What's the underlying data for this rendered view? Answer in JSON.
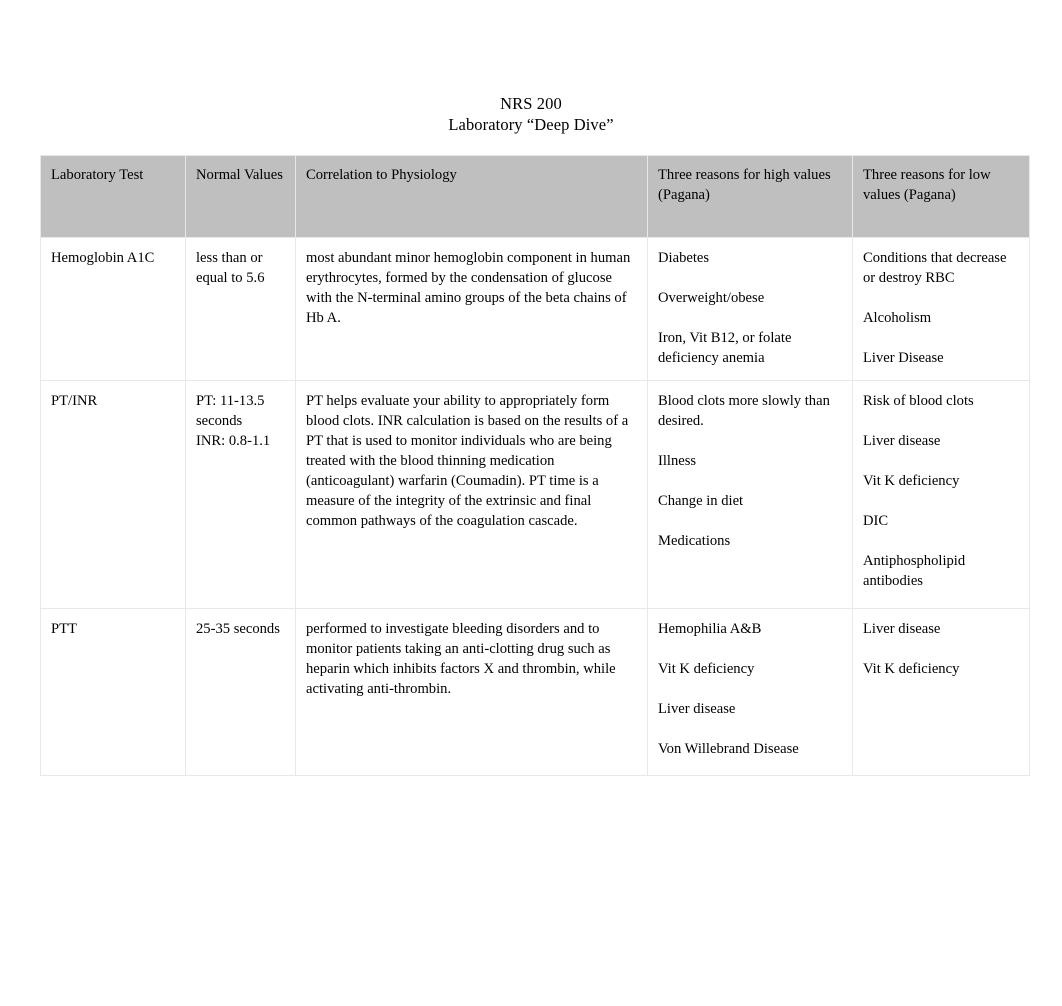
{
  "document": {
    "title_lines": [
      "NRS 200",
      "Laboratory “Deep Dive”"
    ],
    "header_background": "#bfbfbf",
    "page_background": "#ffffff",
    "text_color": "#000000"
  },
  "table": {
    "columns": [
      {
        "key": "test",
        "label": "Laboratory Test"
      },
      {
        "key": "normal",
        "label": "Normal Values"
      },
      {
        "key": "corr",
        "label": "Correlation to Physiology"
      },
      {
        "key": "high",
        "label": "Three reasons for high values (Pagana)"
      },
      {
        "key": "low",
        "label": "Three reasons for low values (Pagana)"
      }
    ],
    "rows": [
      {
        "test": "Hemoglobin A1C",
        "normal": "less than or equal to 5.6",
        "correlation": "most abundant minor hemoglobin component in human erythrocytes, formed by the condensation of glucose with the N-terminal amino groups of the beta chains of Hb A.",
        "high_values": [
          "Diabetes",
          "Overweight/obese",
          "Iron, Vit B12, or folate deficiency anemia"
        ],
        "low_values": [
          "Conditions that decrease or destroy RBC",
          "Alcoholism",
          "Liver Disease"
        ]
      },
      {
        "test": "PT/INR",
        "normal": "PT: 11-13.5 seconds\nINR: 0.8-1.1",
        "correlation": "PT helps evaluate your ability to appropriately form blood clots. INR calculation is based on the results of a PT that is used to monitor individuals who are being treated with the blood thinning medication (anticoagulant) warfarin (Coumadin). PT time is a measure of the integrity of the extrinsic and final common pathways of the coagulation cascade.",
        "high_values": [
          "Blood clots more slowly than desired.",
          "Illness",
          "Change in diet",
          "Medications"
        ],
        "low_values": [
          "Risk of blood clots",
          "Liver disease",
          "Vit K deficiency",
          "DIC",
          "Antiphospholipid antibodies"
        ]
      },
      {
        "test": "PTT",
        "normal": "25-35 seconds",
        "correlation": "performed to investigate bleeding disorders and to monitor patients taking an anti-clotting drug such as heparin which inhibits factors X and thrombin, while activating anti-thrombin.",
        "high_values": [
          "Hemophilia A&B",
          "Vit K deficiency",
          "Liver disease",
          "Von Willebrand Disease"
        ],
        "low_values": [
          "Liver disease",
          "Vit K deficiency"
        ]
      }
    ]
  }
}
